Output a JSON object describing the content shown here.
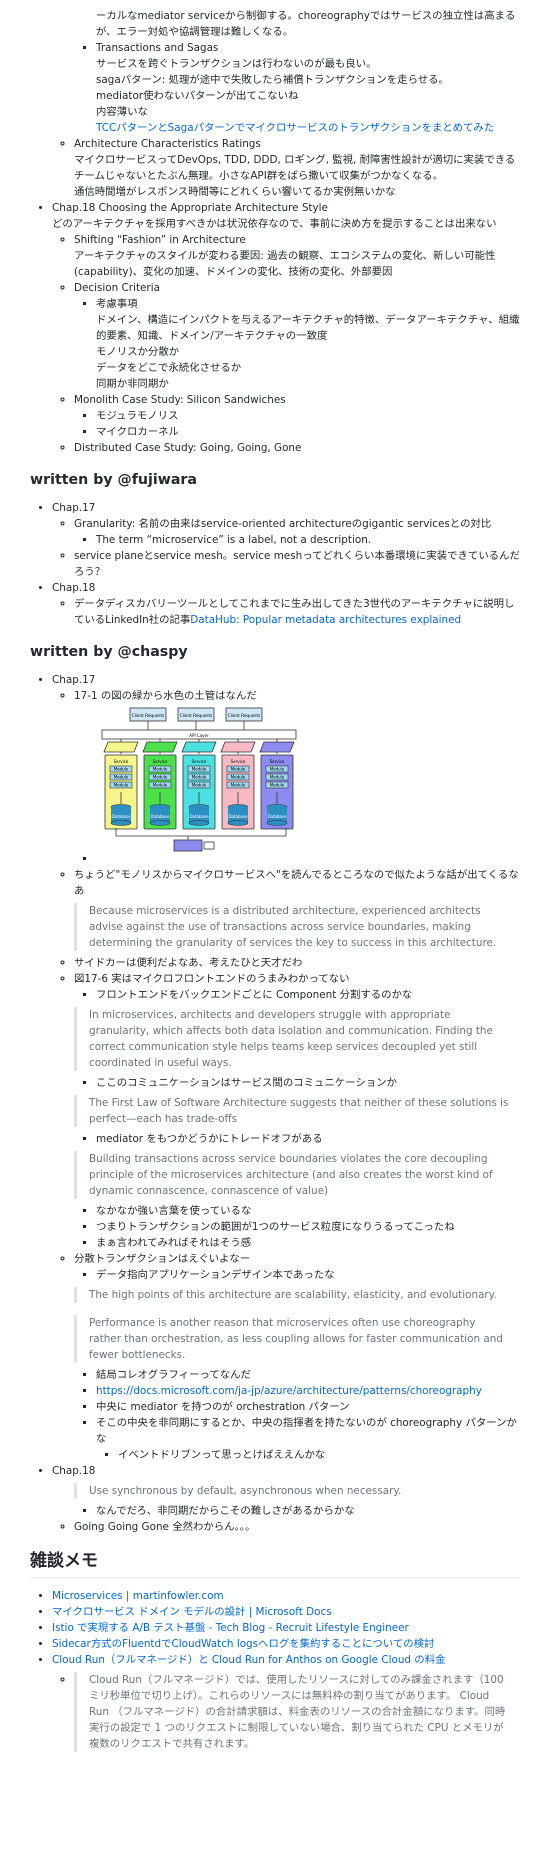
{
  "top": {
    "intro_cont": "ーカルなmediator serviceから制御する。choreographyではサービスの独立性は高まるが、エラー対処や協調管理は難しくなる。",
    "ts_title": "Transactions and Sagas",
    "ts_lines": [
      "サービスを跨ぐトランザクションは行わないのが最も良い。",
      "sagaパターン: 処理が途中で失敗したら補償トランザクションを走らせる。",
      "mediator使わないパターンが出てこないね",
      "内容薄いな"
    ],
    "ts_link": "TCCパターンとSagaパターンでマイクロサービスのトランザクションをまとめてみた",
    "acr_title": "Architecture Characteristics Ratings",
    "acr_lines": [
      "マイクロサービスってDevOps, TDD, DDD, ロギング, 監視, 耐障害性設計が適切に実装できるチームじゃないとたぶん無理。小さなAPI群をばら撒いて収集がつかなくなる。",
      "通信時間増がレスポンス時間等にどれくらい響いてるか実例無いかな"
    ],
    "ch18_title": "Chap.18 Choosing the Appropriate Architecture Style",
    "ch18_desc": "どのアーキテクチャを採用すべきかは状況依存なので、事前に決め方を提示することは出来ない",
    "sf_title": "Shifting “Fashion” in Architecture",
    "sf_desc": "アーキテクチャのスタイルが変わる要因: 過去の観察、エコシステムの変化、新しい可能性(capability)、変化の加速、ドメインの変化、技術の変化、外部要因",
    "dc_title": "Decision Criteria",
    "dc_sub_title": "考慮事項",
    "dc_sub_lines": [
      "ドメイン、構造にインパクトを与えるアーキテクチャ的特徴、データアーキテクチャ、組織的要素、知識、ドメイン/アーキテクチャの一致度",
      "モノリスか分散か",
      "データをどこで永続化させるか",
      "同期か非同期か"
    ],
    "mono_title": "Monolith Case Study: Silicon Sandwiches",
    "mono_items": [
      "モジュラモノリス",
      "マイクロカーネル"
    ],
    "dist_title": "Distributed Case Study: Going, Going, Gone"
  },
  "fujiwara": {
    "heading": "written by @fujiwara",
    "ch17": "Chap.17",
    "gran": "Granularity: 名前の由来はservice-oriented architectureのgigantic servicesとの対比",
    "term": "The term “microservice” is a label, not a description.",
    "mesh": "service planeとservice mesh。service meshってどれくらい本番環境に実装できているんだろう？",
    "ch18": "Chap.18",
    "dd_text": "データディスカバリーツールとしてこれまでに生み出してきた3世代のアーキテクチャに説明しているLinkedIn社の記事",
    "dd_link": "DataHub: Popular metadata architectures explained"
  },
  "chaspy": {
    "heading": "written by @chaspy",
    "ch17": "Chap.17",
    "q17_1": "17-1 の図の緑から水色の土管はなんだ",
    "diagram": {
      "client_requests": [
        "Client Requests",
        "Client Requests",
        "Client Requests"
      ],
      "api_layer": "API Layer",
      "service": "Service",
      "module": "Module",
      "database": "Database",
      "colors": [
        "#f5f58a",
        "#4de04d",
        "#4de0e0",
        "#f7b9c4",
        "#8c8cf0"
      ],
      "box_border": "#333333"
    },
    "monolith_read": "ちょうど\"モノリスからマイクロサービスへ\"を読んでるところなので似たような話が出てくるなあ",
    "quote1": "Because microservices is a distributed architecture, experienced architects advise against the use of transactions across service boundaries, making determining the granularity of services the key to success in this architecture.",
    "sidecar": "サイドカーは便利だよなあ、考えたひと天才だわ",
    "fig17_6": "図17-6 実はマイクロフロントエンドのうまみわかってない",
    "frontend": "フロントエンドをバックエンドごとに Component 分割するのかな",
    "quote2": "In microservices, architects and developers struggle with appropriate granularity, which affects both data isolation and communication. Finding the correct communication style helps teams keep services decoupled yet still coordinated in useful ways.",
    "comm": "ここのコミュニケーションはサービス間のコミュニケーションか",
    "quote3": "The First Law of Software Architecture suggests that neither of these solutions is perfect—each has trade-offs",
    "mediator_trade": "mediator をもつかどうかにトレードオフがある",
    "quote4": "Building transactions across service boundaries violates the core decoupling principle of the microservices architecture (and also creates the worst kind of dynamic connascence, connascence of value)",
    "strong_words": [
      "なかなか強い言葉を使っているな",
      "つまりトランザクションの範囲が1つのサービス粒度になりうるってこったね",
      "まぁ言われてみればそれはそう感"
    ],
    "dist_tx": "分散トランザクションはえぐいよなー",
    "data_book": "データ指向アプリケーションデザイン本であったな",
    "quote5": "The high points of this architecture are scalability, elasticity, and evolutionary.",
    "quote6": "Performance is another reason that microservices often use choreography rather than orchestration, as less coupling allows for faster communication and fewer bottlenecks.",
    "choreo_items": [
      "結局コレオグラフィーってなんだ",
      "https://docs.microsoft.com/ja-jp/azure/architecture/patterns/choreography",
      "中央に mediator を持つのが orchestration パターン",
      "そこの中央を非同期にするとか、中央の指揮者を持たないのが choreography パターンかな"
    ],
    "event_driven": "イベントドリブンって思っとけばええんかな",
    "ch18": "Chap.18",
    "quote7": "Use synchronous by default, asynchronous when necessary.",
    "async_note": "なんでだろ、非同期だからこその難しさがあるからかな",
    "going": "Going Going Gone 全然わからん。。。"
  },
  "memo": {
    "heading": "雑談メモ",
    "links": [
      "Microservices | martinfowler.com",
      "マイクロサービス ドメイン モデルの設計 | Microsoft Docs",
      "Istio で実現する A/B テスト基盤 - Tech Blog - Recruit Lifestyle Engineer",
      "Sidecar方式のFluentdでCloudWatch logsへログを集約することについての検討",
      "Cloud Run（フルマネージド）と Cloud Run for Anthos on Google Cloud の料金"
    ],
    "quote_cloudrun": "Cloud Run（フルマネージド）では、使用したリソースに対してのみ課金されます（100 ミリ秒単位で切り上げ）。これらのリソースには無料枠の割り当てがあります。 Cloud Run （フルマネージド）の合計請求額は、料金表のリソースの合計金額になります。同時実行の設定で 1 つのリクエストに制限していない場合、割り当てられた CPU とメモリが複数のリクエストで共有されます。"
  },
  "colors": {
    "link": "#0366d6",
    "quote_text": "#6a737d",
    "quote_border": "#dfe2e5",
    "text": "#24292e"
  }
}
